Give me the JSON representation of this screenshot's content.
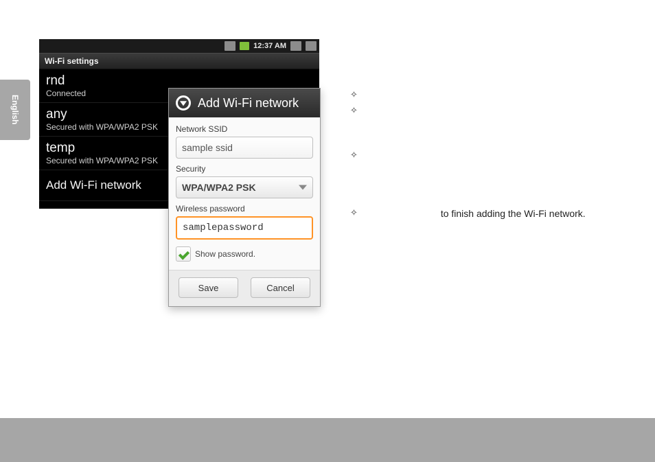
{
  "page": {
    "language_tab": "English"
  },
  "instructions": {
    "line1": "",
    "line2": "",
    "line3": "",
    "line4_suffix": "to finish adding the Wi-Fi network."
  },
  "phone": {
    "status": {
      "time": "12:37 AM"
    },
    "title": "Wi-Fi settings",
    "networks": [
      {
        "name": "rnd",
        "sub": "Connected"
      },
      {
        "name": "any",
        "sub": "Secured with WPA/WPA2 PSK"
      },
      {
        "name": "temp",
        "sub": "Secured with WPA/WPA2 PSK"
      }
    ],
    "add_cta": "Add Wi-Fi network"
  },
  "dialog": {
    "title": "Add Wi-Fi network",
    "ssid_label": "Network SSID",
    "ssid_value": "sample ssid",
    "security_label": "Security",
    "security_value": "WPA/WPA2 PSK",
    "password_label": "Wireless password",
    "password_value": "samplepassword",
    "show_password_label": "Show password.",
    "save_label": "Save",
    "cancel_label": "Cancel"
  }
}
